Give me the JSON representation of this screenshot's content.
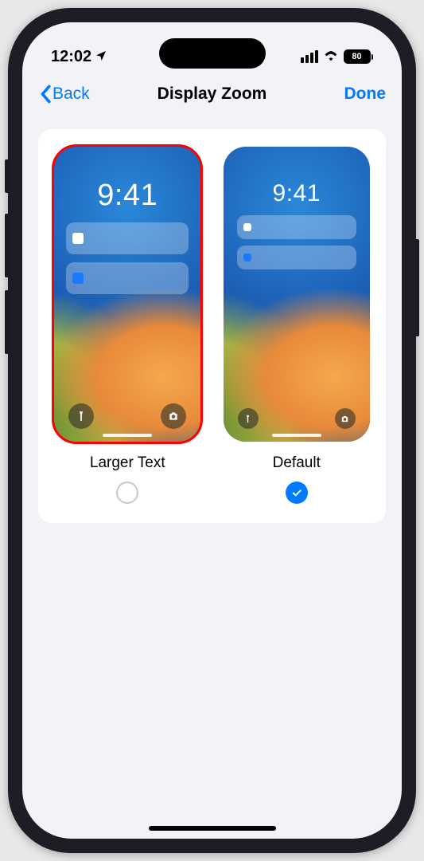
{
  "statusBar": {
    "time": "12:02",
    "batteryPercent": "80"
  },
  "nav": {
    "back": "Back",
    "title": "Display Zoom",
    "done": "Done"
  },
  "options": {
    "larger": {
      "label": "Larger Text",
      "previewTime": "9:41",
      "selected": false,
      "highlighted": true
    },
    "default": {
      "label": "Default",
      "previewTime": "9:41",
      "selected": true,
      "highlighted": false
    }
  }
}
